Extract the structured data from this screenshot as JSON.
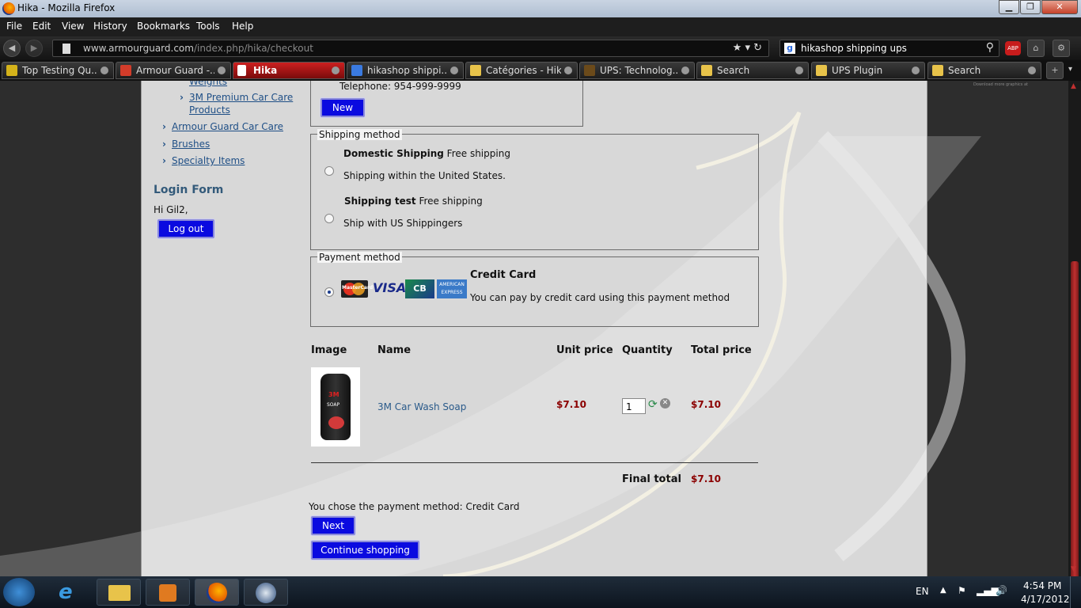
{
  "window": {
    "title": "Hika - Mozilla Firefox",
    "btn_min": "▁",
    "btn_max": "❐",
    "btn_close": "✕"
  },
  "menu": [
    "File",
    "Edit",
    "View",
    "History",
    "Bookmarks",
    "Tools",
    "Help"
  ],
  "nav": {
    "url_domain": "www.armourguard.com",
    "url_path": "/index.php/hika/checkout",
    "search_query": "hikashop shipping ups",
    "abp_label": "ABP"
  },
  "tabs": [
    {
      "label": "Top Testing Qu...",
      "color": "#d4b21a"
    },
    {
      "label": "Armour Guard -...",
      "color": "#d23c2a"
    },
    {
      "label": "Hika",
      "color": "#ffffff"
    },
    {
      "label": "hikashop shippi...",
      "color": "#3a7ae0"
    },
    {
      "label": "Catégories - Hik...",
      "color": "#e8c34a"
    },
    {
      "label": "UPS: Technolog...",
      "color": "#6b4a1a"
    },
    {
      "label": "Search",
      "color": "#e8c34a"
    },
    {
      "label": "UPS Plugin",
      "color": "#e8c34a"
    },
    {
      "label": "Search",
      "color": "#e8c34a"
    }
  ],
  "sidebar": {
    "partial_link": "Weights",
    "link_3m": "3M Premium Car Care",
    "link_3m_2": "Products",
    "link_armour": "Armour Guard Car Care",
    "link_brushes": "Brushes",
    "link_specialty": "Specialty Items",
    "login_title": "Login Form",
    "greeting": "Hi Gil2,",
    "logout": "Log out"
  },
  "address": {
    "telephone": "Telephone: 954-999-9999",
    "new_button": "New"
  },
  "shipping": {
    "legend": "Shipping method",
    "options": [
      {
        "name": "Domestic Shipping",
        "price": " Free shipping",
        "desc": "Shipping within the United States."
      },
      {
        "name": "Shipping test",
        "price": " Free shipping",
        "desc": "Ship with US Shippingers"
      }
    ]
  },
  "payment": {
    "legend": "Payment method",
    "name": "Credit Card",
    "desc": "You can pay by credit card using this payment method",
    "cards": [
      "MasterCard",
      "VISA",
      "CB",
      "AMERICAN EXPRESS"
    ]
  },
  "cart": {
    "headers": [
      "Image",
      "Name",
      "Unit price",
      "Quantity",
      "Total price"
    ],
    "item": {
      "name": "3M Car Wash Soap",
      "unit_price": "$7.10",
      "quantity": "1",
      "total": "$7.10",
      "label_3m": "3M",
      "label_soap": "SOAP"
    },
    "final_label": "Final total",
    "final_value": "$7.10"
  },
  "footer": {
    "chosen": "You chose the payment method: Credit Card",
    "next": "Next",
    "continue": "Continue shopping",
    "tiny_note": "Download more graphics at"
  },
  "taskbar": {
    "lang": "EN",
    "time": "4:54 PM",
    "date": "4/17/2012"
  }
}
